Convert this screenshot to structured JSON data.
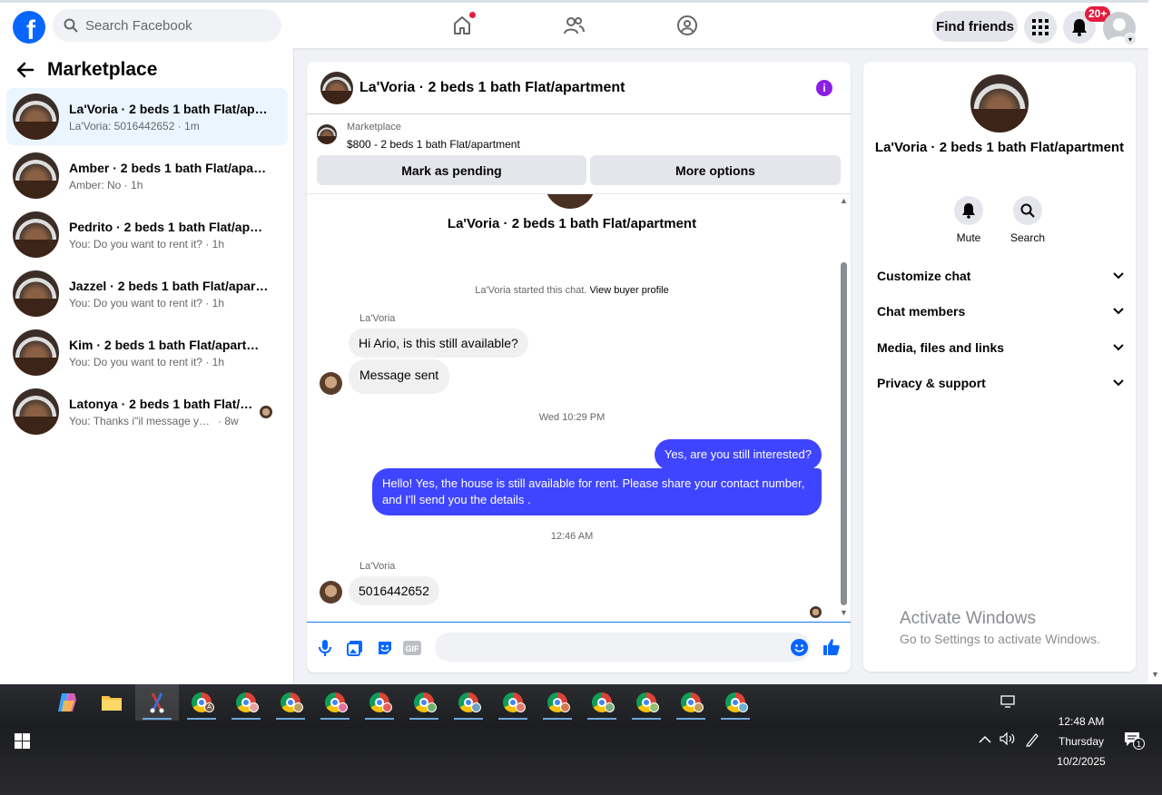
{
  "topnav": {
    "search_placeholder": "Search Facebook",
    "find_friends": "Find friends",
    "notif_count": "20+"
  },
  "sidebar": {
    "title": "Marketplace",
    "conversations": [
      {
        "name": "La'Voria · 2 beds 1 bath Flat/apart...",
        "preview": "La'Voria: 5016442652 · 1m"
      },
      {
        "name": "Amber · 2 beds 1 bath Flat/apartm...",
        "preview": "Amber: No · 1h"
      },
      {
        "name": "Pedrito · 2 beds 1 bath Flat/apartm...",
        "preview": "You: Do you want to rent it? · 1h"
      },
      {
        "name": "Jazzel · 2 beds 1 bath Flat/apartment",
        "preview": "You: Do you want to rent it? · 1h"
      },
      {
        "name": "Kim · 2 beds 1 bath Flat/apartment",
        "preview": "You: Do you want to rent it? · 1h"
      },
      {
        "name": "Latonya · 2 beds 1 bath Flat/apa...",
        "preview": "You: Thanks i\"il message you in a ...",
        "time": "· 8w"
      }
    ]
  },
  "chat": {
    "title": "La'Voria · 2 beds 1 bath Flat/apartment",
    "marketplace_label": "Marketplace",
    "listing": "$800 - 2 beds 1 bath Flat/apartment",
    "mark_pending": "Mark as pending",
    "more_options": "More options",
    "thread_title": "La'Voria · 2 beds 1 bath Flat/apartment",
    "started_text": "La'Voria started this chat.",
    "view_profile": "View buyer profile",
    "sender1": "La'Voria",
    "msg1": "Hi Ario, is this still available?",
    "msg2": "Message sent",
    "ts1": "Wed 10:29 PM",
    "out1": "Yes, are you still interested?",
    "out2": "Hello! Yes, the house is still available for rent. Please share your contact number, and I'll send you the details .",
    "ts2": "12:46 AM",
    "sender2": "La'Voria",
    "msg3": "5016442652"
  },
  "right": {
    "title": "La'Voria · 2 beds 1 bath Flat/apartment",
    "mute": "Mute",
    "search": "Search",
    "sections": [
      "Customize chat",
      "Chat members",
      "Media, files and links",
      "Privacy & support"
    ]
  },
  "watermark": {
    "line1": "Activate Windows",
    "line2": "Go to Settings to activate Windows."
  },
  "taskbar": {
    "time": "12:48 AM",
    "day": "Thursday",
    "date": "10/2/2025",
    "notif_count": "1"
  }
}
